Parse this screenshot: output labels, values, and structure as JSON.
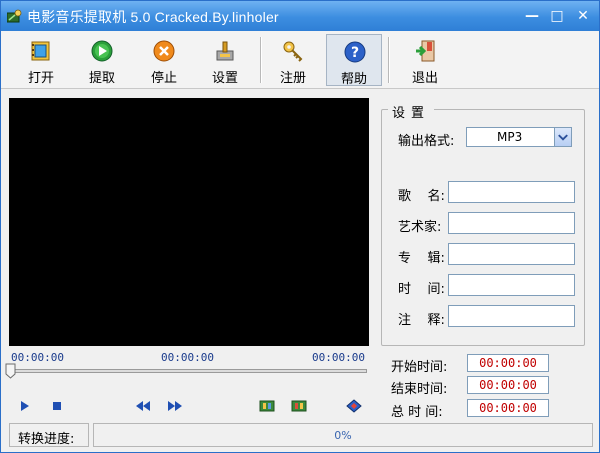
{
  "window": {
    "title": "电影音乐提取机 5.0  Cracked.By.linholer",
    "min_glyph": "—",
    "max_glyph": "□",
    "close_glyph": "✕"
  },
  "toolbar": {
    "items": [
      {
        "label": "打开",
        "icon": "open-film-icon"
      },
      {
        "label": "提取",
        "icon": "play-extract-icon"
      },
      {
        "label": "停止",
        "icon": "stop-icon"
      },
      {
        "label": "设置",
        "icon": "settings-icon"
      },
      {
        "label": "注册",
        "icon": "key-icon"
      },
      {
        "label": "帮助",
        "icon": "help-icon",
        "pressed": true
      },
      {
        "label": "退出",
        "icon": "exit-icon"
      }
    ]
  },
  "player": {
    "time_current": "00:00:00",
    "time_middle": "00:00:00",
    "time_total": "00:00:00",
    "seek_position": 0
  },
  "settings": {
    "legend": "设置",
    "format_label": "输出格式:",
    "format_value": "MP3",
    "fields": [
      {
        "label": "歌    名:",
        "value": ""
      },
      {
        "label": "艺术家:",
        "value": ""
      },
      {
        "label": "专    辑:",
        "value": ""
      },
      {
        "label": "时    间:",
        "value": ""
      },
      {
        "label": "注    释:",
        "value": ""
      }
    ]
  },
  "times": {
    "start_label": "开始时间:",
    "start_value": "00:00:00",
    "end_label": "结束时间:",
    "end_value": "00:00:00",
    "total_label": "总 时 间:",
    "total_value": "00:00:00"
  },
  "status": {
    "label": "转换进度:",
    "progress": 0,
    "progress_text": "0%"
  },
  "colors": {
    "titlebar": "#3c8de0",
    "accent": "#2f7fd6",
    "time_red": "#c00000",
    "timecode_blue": "#1a3b8c"
  }
}
